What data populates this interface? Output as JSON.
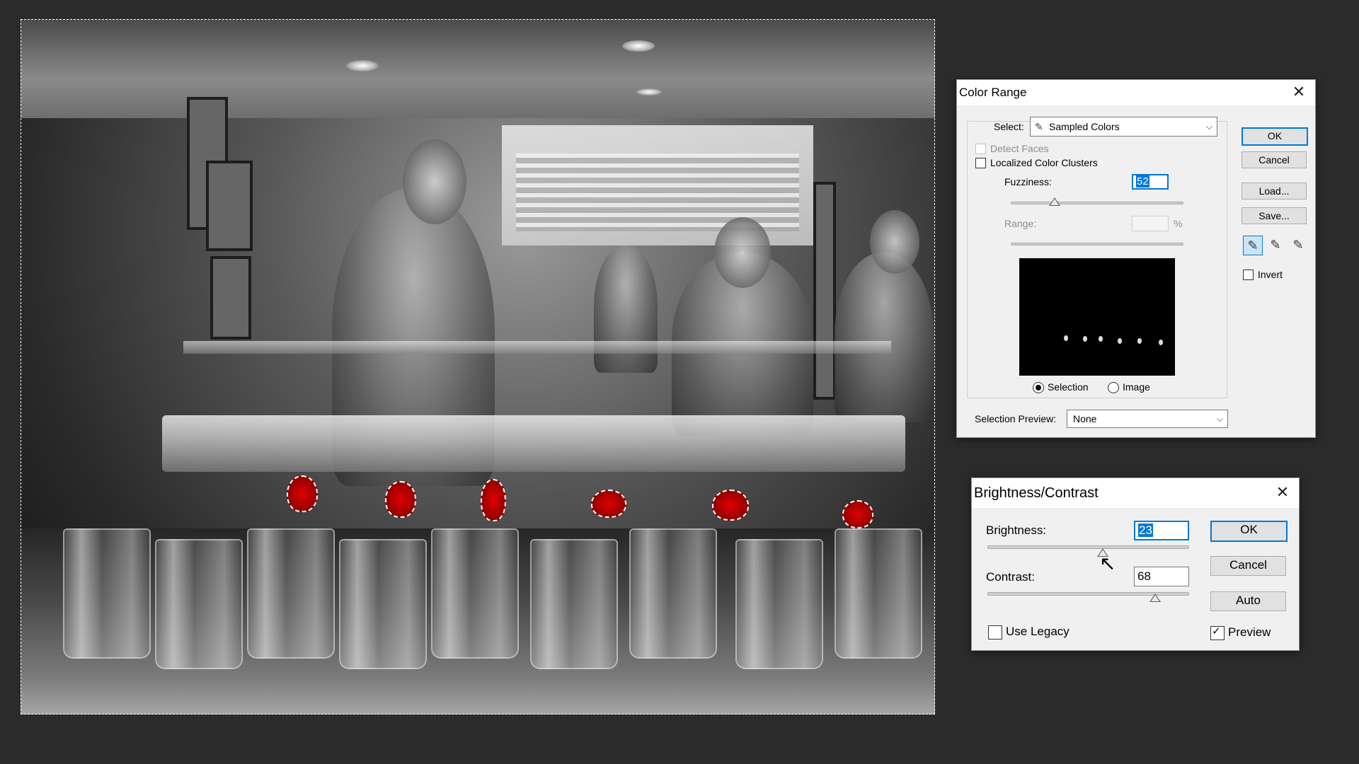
{
  "colors": {
    "accent": "#0078d7",
    "selection_red": "#c00000",
    "background": "#2b2b2b"
  },
  "color_range": {
    "title": "Color Range",
    "close_icon": "close-icon",
    "select_label": "Select:",
    "select_value": "Sampled Colors",
    "detect_faces_label": "Detect Faces",
    "localized_label": "Localized Color Clusters",
    "fuzziness_label": "Fuzziness:",
    "fuzziness_value": "52",
    "range_label": "Range:",
    "range_unit": "%",
    "selection_radio_label": "Selection",
    "image_radio_label": "Image",
    "selection_preview_label": "Selection Preview:",
    "selection_preview_value": "None",
    "ok_label": "OK",
    "cancel_label": "Cancel",
    "load_label": "Load...",
    "save_label": "Save...",
    "invert_label": "Invert",
    "eyedroppers": [
      "eyedropper-icon",
      "eyedropper-plus-icon",
      "eyedropper-minus-icon"
    ]
  },
  "brightness_contrast": {
    "title": "Brightness/Contrast",
    "close_icon": "close-icon",
    "brightness_label": "Brightness:",
    "brightness_value": "23",
    "contrast_label": "Contrast:",
    "contrast_value": "68",
    "use_legacy_label": "Use Legacy",
    "use_legacy_checked": false,
    "preview_label": "Preview",
    "preview_checked": true,
    "ok_label": "OK",
    "cancel_label": "Cancel",
    "auto_label": "Auto"
  }
}
